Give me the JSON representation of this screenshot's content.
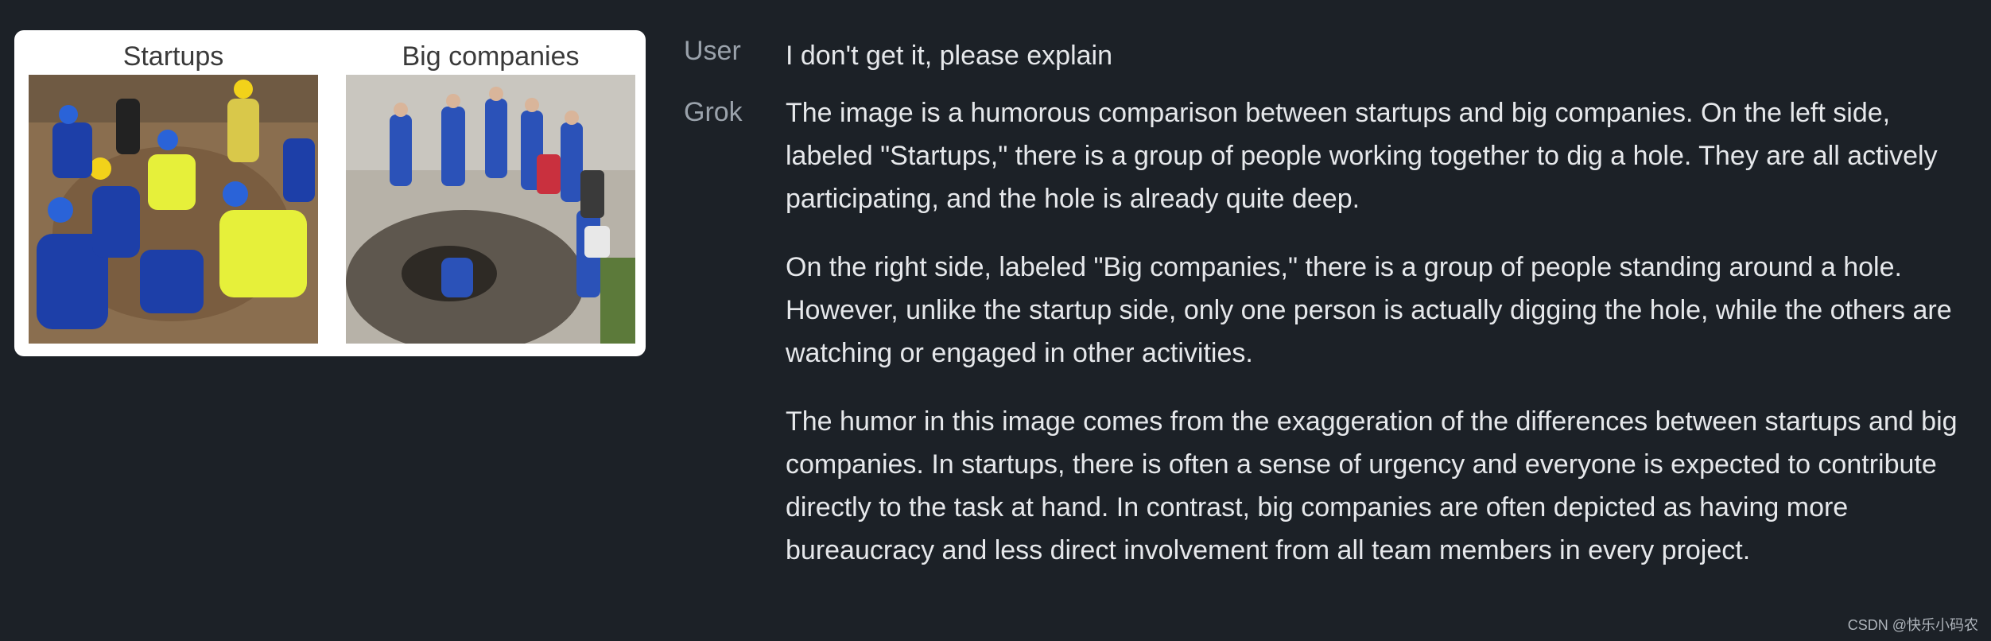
{
  "meme": {
    "left_label": "Startups",
    "right_label": "Big companies"
  },
  "conversation": {
    "user": {
      "speaker": "User",
      "text": "I don't get it, please explain"
    },
    "grok": {
      "speaker": "Grok",
      "paragraphs": [
        "The image is a humorous comparison between startups and big companies. On the left side, labeled \"Startups,\" there is a group of people working together to dig a hole. They are all actively participating, and the hole is already quite deep.",
        "On the right side, labeled \"Big companies,\" there is a group of people standing around a hole. However, unlike the startup side, only one person is actually digging the hole, while the others are watching or engaged in other activities.",
        "The humor in this image comes from the exaggeration of the differences between startups and big companies. In startups, there is often a sense of urgency and everyone is expected to contribute directly to the task at hand. In contrast, big companies are often depicted as having more bureaucracy and less direct involvement from all team members in every project."
      ]
    }
  },
  "watermark": "CSDN @快乐小码农",
  "colors": {
    "background": "#1c2127",
    "speaker_text": "#9aa2ab",
    "message_text": "#e6e8eb",
    "card": "#ffffff"
  }
}
